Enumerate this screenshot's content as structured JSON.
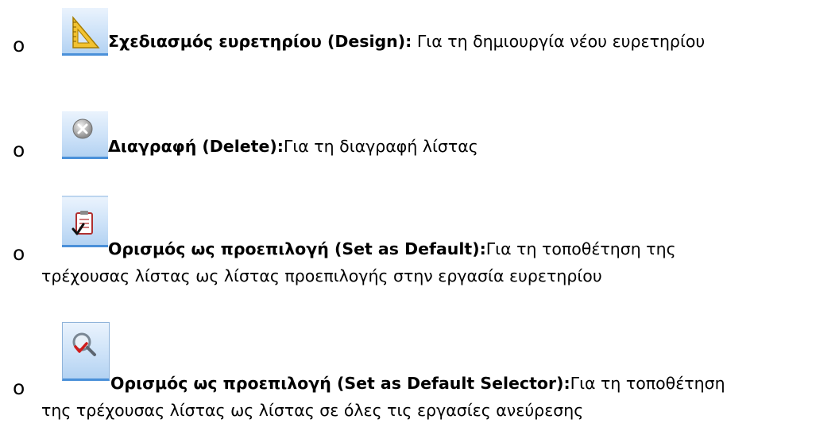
{
  "items": [
    {
      "bullet": "o",
      "icon": "ruler-triangle-icon",
      "title": "Σχεδιασμός ευρετηρίου (Design):",
      "description": " Για τη δημιουργία νέου ευρετηρίου"
    },
    {
      "bullet": "o",
      "icon": "delete-circle-icon",
      "title": "Διαγραφή (Delete):",
      "description": "Για τη διαγραφή λίστας"
    },
    {
      "bullet": "o",
      "icon": "clipboard-check-icon",
      "title": "Ορισμός ως προεπιλογή (Set as Default):",
      "description": "Για τη τοποθέτηση της",
      "description_line2": "τρέχουσας λίστας ως λίστας προεπιλογής στην εργασία ευρετηρίου"
    },
    {
      "bullet": "o",
      "icon": "magnifier-check-icon",
      "title": "Ορισμός ως προεπιλογή  (Set as Default Selector):",
      "description": "Για τη τοποθέτηση",
      "description_line2": "της τρέχουσας λίστας ως λίστας σε όλες τις εργασίες ανεύρεσης"
    }
  ],
  "colors": {
    "icon_background": "#cde2f8",
    "icon_border": "#4a90d9",
    "ruler_yellow": "#f2c230",
    "check_red": "#d01c1c"
  }
}
